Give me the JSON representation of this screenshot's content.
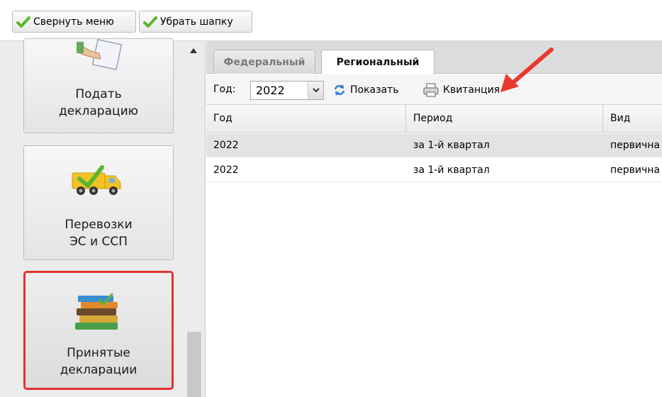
{
  "toolbar": {
    "collapse_menu_label": "Свернуть меню",
    "hide_header_label": "Убрать шапку"
  },
  "sidebar": {
    "tiles": [
      {
        "label": "Подать\nдекларацию"
      },
      {
        "label": "Перевозки\nЭС и ССП"
      },
      {
        "label": "Принятые\nдекларации"
      }
    ]
  },
  "tabs": [
    {
      "label": "Федеральный",
      "active": false
    },
    {
      "label": "Региональный",
      "active": true
    }
  ],
  "filter": {
    "year_label": "Год:",
    "year_value": "2022",
    "show_label": "Показать",
    "receipt_label": "Квитанция"
  },
  "grid": {
    "columns": [
      "Год",
      "Период",
      "Вид"
    ],
    "rows": [
      [
        "2022",
        "за 1-й квартал",
        "первична"
      ],
      [
        "2022",
        "за 1-й квартал",
        "первична"
      ]
    ]
  },
  "colors": {
    "check_green": "#5cb531",
    "arrow_red": "#e8392f",
    "selected_border": "#e0332e",
    "refresh_blue": "#2f7fd1"
  }
}
